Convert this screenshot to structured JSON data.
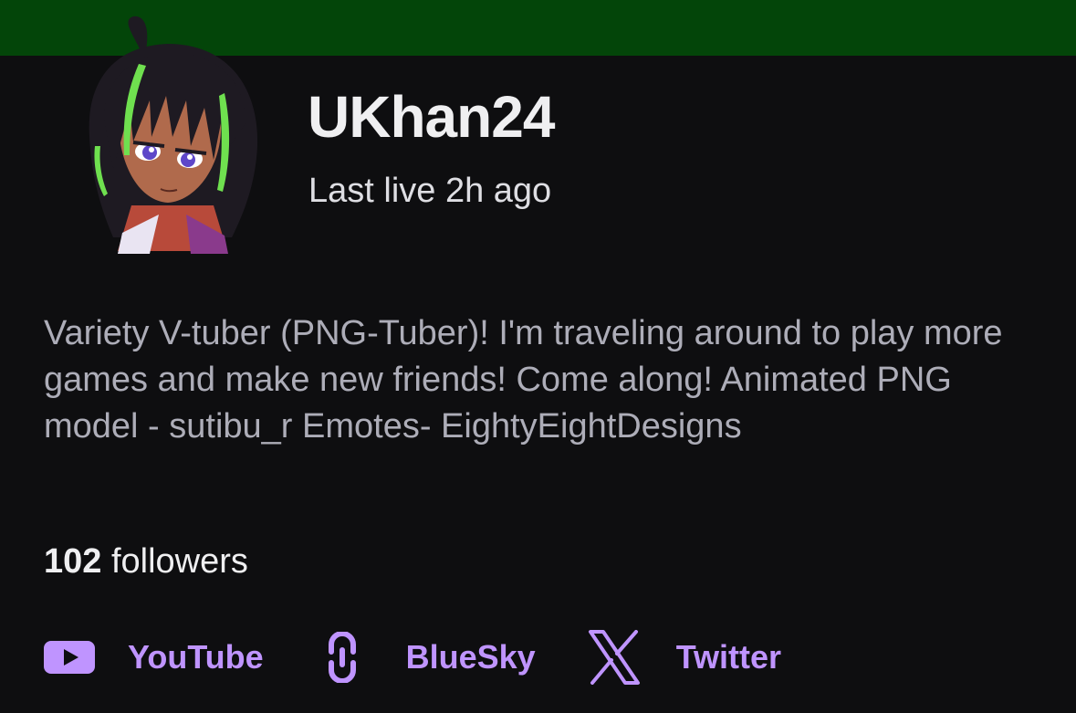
{
  "channel": {
    "name": "UKhan24",
    "last_live": "Last live 2h ago",
    "avatar": "anime-vtuber-avatar"
  },
  "about": {
    "bio": "Variety V-tuber (PNG-Tuber)! I'm traveling around to play more games and make new friends! Come along! Animated PNG model - sutibu_r Emotes- EightyEightDesigns",
    "followers_count": "102",
    "followers_label": "followers"
  },
  "social_links": [
    {
      "label": "YouTube",
      "icon": "youtube-icon"
    },
    {
      "label": "BlueSky",
      "icon": "link-icon"
    },
    {
      "label": "Twitter",
      "icon": "x-logo-icon"
    }
  ],
  "colors": {
    "banner": "#034509",
    "background": "#0e0e10",
    "link": "#bf94ff",
    "primary_text": "#efeff1",
    "secondary_text": "#adadb8"
  }
}
